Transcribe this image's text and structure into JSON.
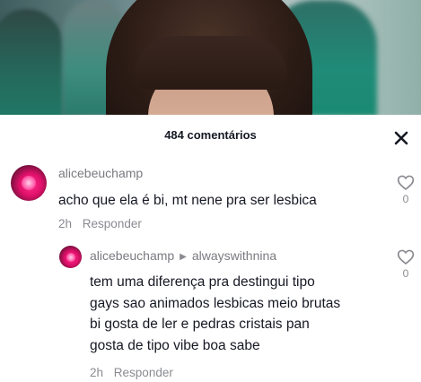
{
  "header": {
    "comment_count_label": "484 comentários"
  },
  "icons": {
    "close": "close-icon",
    "like": "heart-outline-icon",
    "reply_arrow": "play-triangle-icon"
  },
  "colors": {
    "avatar_accent": "#ff2d8a",
    "secondary_text": "#8a8b91"
  },
  "comments": [
    {
      "username": "alicebeuchamp",
      "text": "acho que ela é bi, mt nene pra ser lesbica",
      "time": "2h",
      "reply_label": "Responder",
      "likes": "0"
    }
  ],
  "replies": [
    {
      "username": "alicebeuchamp",
      "reply_to": "alwayswithnina",
      "text_lines": [
        "tem uma diferença pra destingui tipo",
        "gays sao animados lesbicas meio brutas",
        "bi gosta de ler e pedras cristais pan",
        "gosta de tipo vibe boa sabe"
      ],
      "time": "2h",
      "reply_label": "Responder",
      "likes": "0"
    }
  ]
}
